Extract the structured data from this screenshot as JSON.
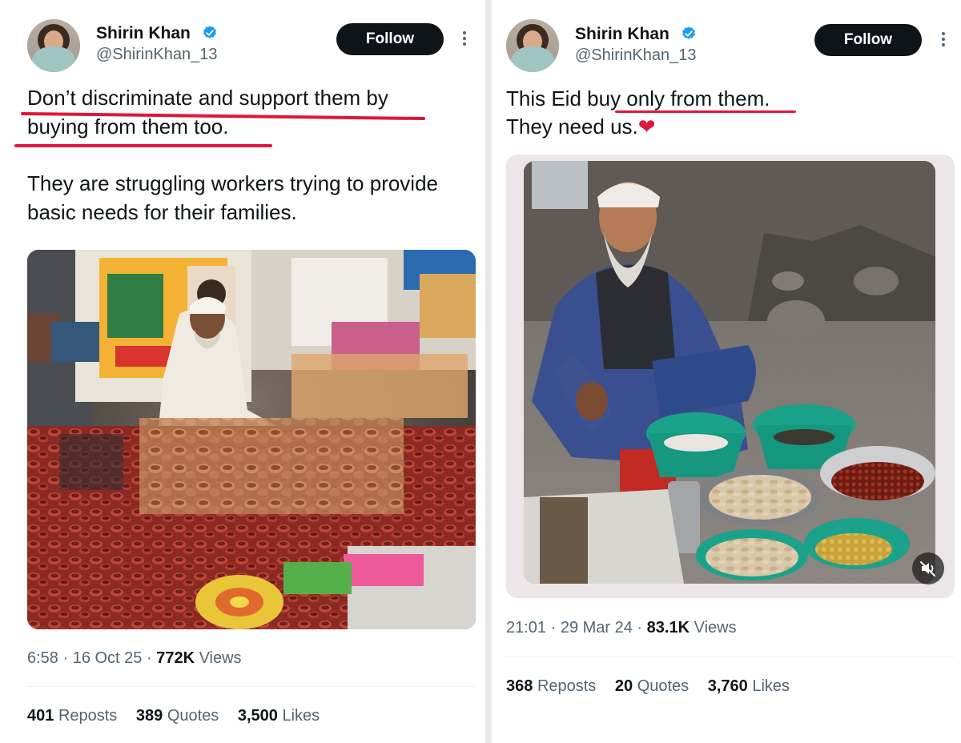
{
  "left_tweet": {
    "author_name": "Shirin Khan",
    "handle": "@ShirinKhan_13",
    "follow_label": "Follow",
    "line1": "Don’t discriminate and support them by",
    "line2": "buying from them too.",
    "line3": "They are struggling workers trying to provide",
    "line4": "basic needs for their families.",
    "time": "6:58 · 16 Oct 25 · ",
    "views_count": "772K",
    "views_label": " Views",
    "reposts_count": "401",
    "reposts_label": "Reposts",
    "quotes_count": "389",
    "quotes_label": "Quotes",
    "likes_count": "3,500",
    "likes_label": "Likes",
    "image_icon": "street-diya-vendor-photo"
  },
  "right_tweet": {
    "author_name": "Shirin Khan",
    "handle": "@ShirinKhan_13",
    "follow_label": "Follow",
    "line1": "This Eid buy only from them.",
    "line2": "They need us.",
    "heart": "❤",
    "time": "21:01 · 29 Mar 24 · ",
    "views_count": "83.1K",
    "views_label": " Views",
    "reposts_count": "368",
    "reposts_label": "Reposts",
    "quotes_count": "20",
    "quotes_label": "Quotes",
    "likes_count": "3,760",
    "likes_label": "Likes",
    "image_icon": "elderly-nut-vendor-photo",
    "mute_icon": "muted-speaker-icon"
  },
  "colors": {
    "text": "#0f1419",
    "muted": "#536471",
    "verified": "#1d9bf0",
    "underline": "#e0163b",
    "follow_bg": "#0f1419"
  }
}
